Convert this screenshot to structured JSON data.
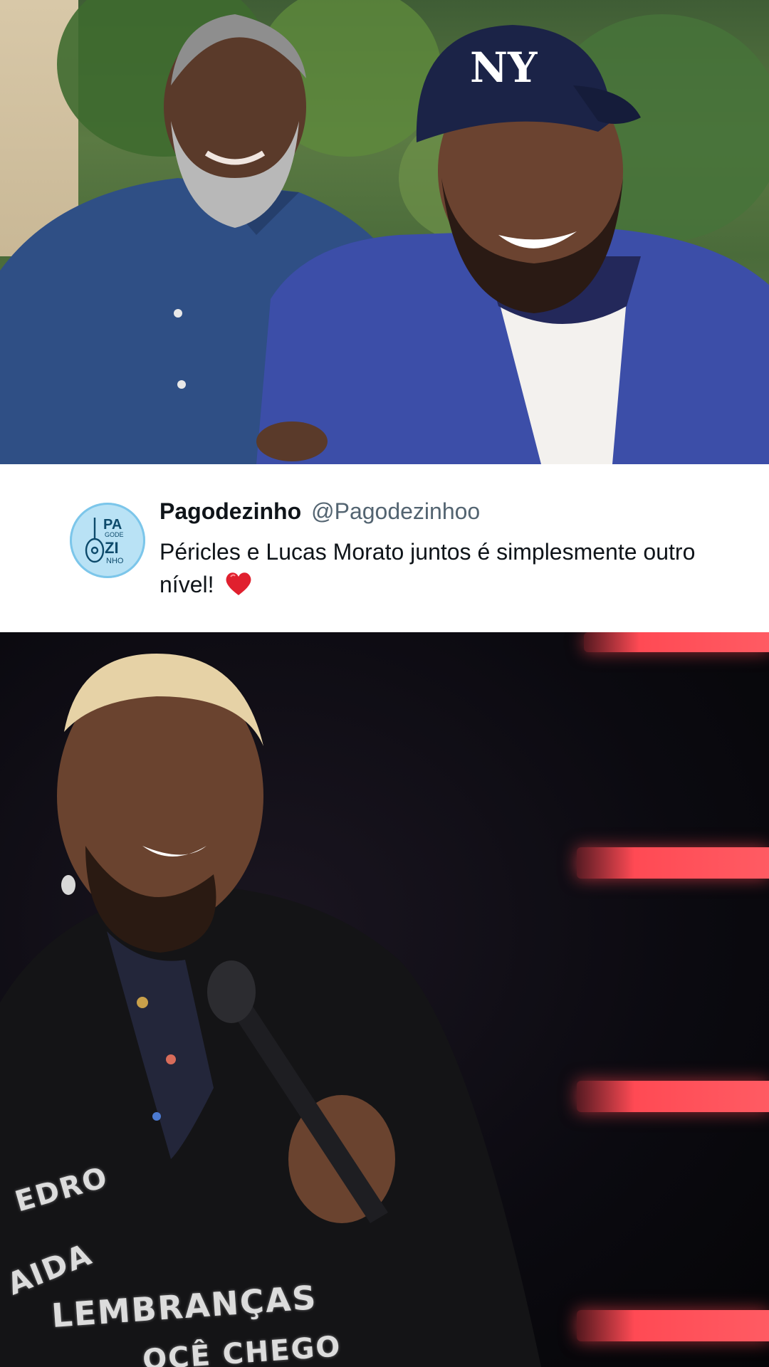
{
  "tweet": {
    "display_name": "Pagodezinho",
    "handle": "@Pagodezinhoo",
    "text": "Péricles e Lucas Morato juntos é simplesmente outro nível!",
    "emoji_icon": "red-heart-icon",
    "avatar_logo_text": "PAGODEZINHO"
  },
  "photo_bottom": {
    "shirt_words": [
      "EDRO",
      "AIDA",
      "LEMBRANÇAS",
      "OCÊ CHEGO"
    ]
  },
  "colors": {
    "name": "#0f1419",
    "handle": "#536471",
    "avatar_bg": "#b9e2f5",
    "stage_light": "#ff4a54"
  }
}
